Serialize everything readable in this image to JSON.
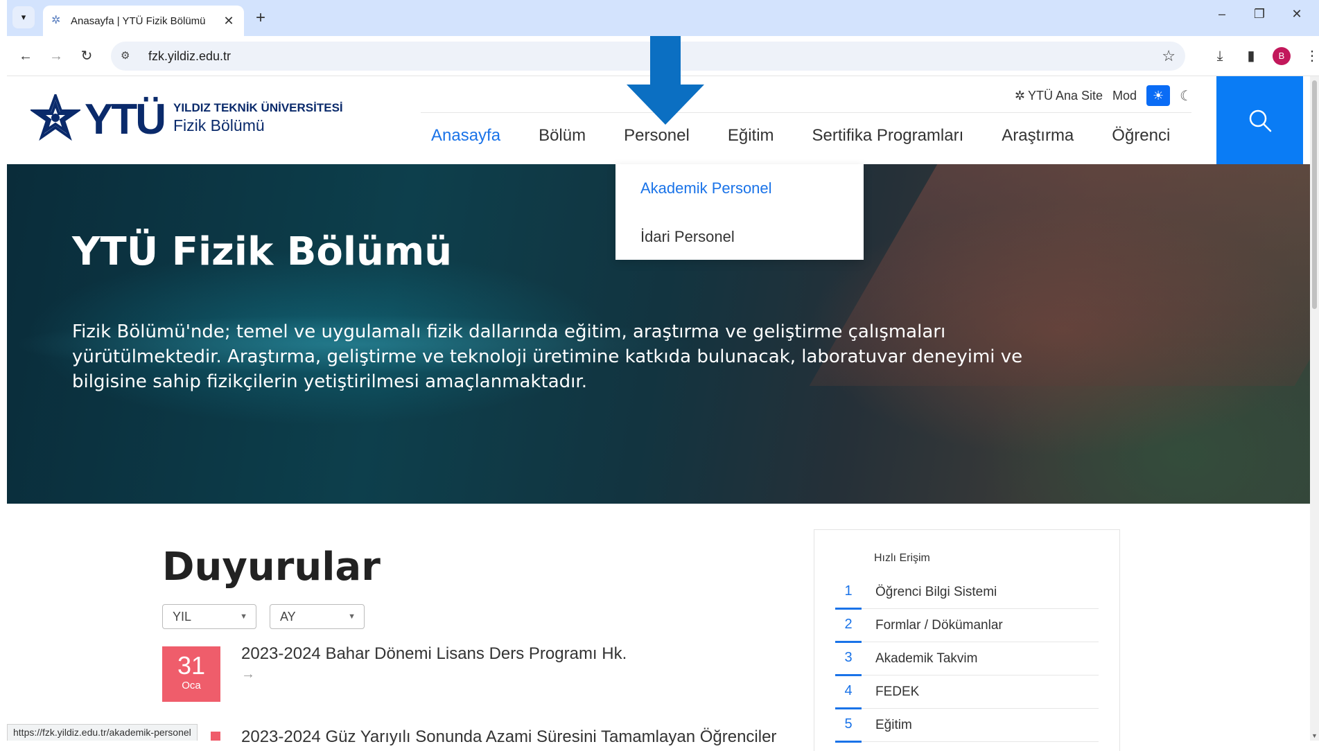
{
  "browser": {
    "tab_title": "Anasayfa | YTÜ Fizik Bölümü",
    "url": "fzk.yildiz.edu.tr",
    "profile_initial": "B",
    "status_url": "https://fzk.yildiz.edu.tr/akademik-personel"
  },
  "header": {
    "logo_mark": "YTÜ",
    "university_name": "YILDIZ TEKNİK ÜNİVERSİTESİ",
    "department_name": "Fizik Bölümü",
    "main_site_link": "YTÜ Ana Site",
    "mode_label": "Mod"
  },
  "nav": {
    "items": [
      {
        "label": "Anasayfa",
        "active": true
      },
      {
        "label": "Bölüm",
        "active": false
      },
      {
        "label": "Personel",
        "active": false
      },
      {
        "label": "Eğitim",
        "active": false
      },
      {
        "label": "Sertifika Programları",
        "active": false
      },
      {
        "label": "Araştırma",
        "active": false
      },
      {
        "label": "Öğrenci",
        "active": false
      }
    ]
  },
  "dropdown": {
    "items": [
      "Akademik Personel",
      "İdari Personel"
    ]
  },
  "hero": {
    "title": "YTÜ Fizik Bölümü",
    "text": "Fizik Bölümü'nde; temel ve uygulamalı fizik dallarında eğitim, araştırma ve geliştirme çalışmaları yürütülmektedir. Araştırma, geliştirme ve teknoloji üretimine katkıda bulunacak, laboratuvar deneyimi ve bilgisine sahip fizikçilerin yetiştirilmesi amaçlanmaktadır."
  },
  "announcements": {
    "title": "Duyurular",
    "year_filter": "YIL",
    "month_filter": "AY",
    "items": [
      {
        "day": "31",
        "month": "Oca",
        "title": "2023-2024 Bahar Dönemi Lisans Ders Programı Hk.",
        "arrow": "→"
      },
      {
        "title": "2023-2024 Güz Yarıyılı Sonunda Azami Süresini Tamamlayan Öğrenciler"
      }
    ]
  },
  "quick_access": {
    "title": "Hızlı Erişim",
    "items": [
      {
        "num": "1",
        "label": "Öğrenci Bilgi Sistemi"
      },
      {
        "num": "2",
        "label": "Formlar / Dökümanlar"
      },
      {
        "num": "3",
        "label": "Akademik Takvim"
      },
      {
        "num": "4",
        "label": "FEDEK"
      },
      {
        "num": "5",
        "label": "Eğitim"
      }
    ]
  },
  "colors": {
    "accent": "#1a73e8",
    "search_bg": "#0a7cf5",
    "date_badge": "#ef5d6b",
    "annotation_arrow": "#0b6fc2",
    "logo_navy": "#0a2a6b"
  }
}
